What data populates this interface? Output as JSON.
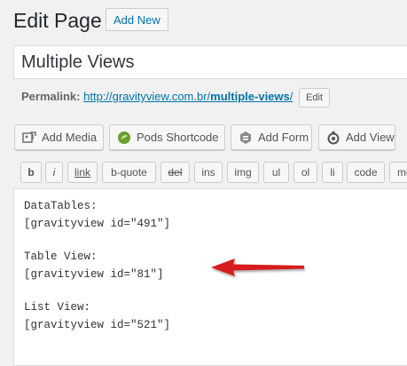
{
  "header": {
    "title": "Edit Page",
    "add_new_label": "Add New"
  },
  "title_field": {
    "value": "Multiple Views"
  },
  "permalink": {
    "label": "Permalink:",
    "url_base": "http://gravityview.com.br/",
    "url_slug": "multiple-views",
    "url_end": "/",
    "edit_label": "Edit"
  },
  "media_buttons": [
    {
      "label": "Add Media",
      "icon": "add-media-icon"
    },
    {
      "label": "Pods Shortcode",
      "icon": "pods-icon"
    },
    {
      "label": "Add Form",
      "icon": "gravity-forms-icon"
    },
    {
      "label": "Add View",
      "icon": "gravityview-icon"
    }
  ],
  "quicktags": [
    "b",
    "i",
    "link",
    "b-quote",
    "del",
    "ins",
    "img",
    "ul",
    "ol",
    "li",
    "code",
    "mo"
  ],
  "editor": {
    "lines": [
      "DataTables:",
      "[gravityview id=\"491\"]",
      "",
      "Table View:",
      "[gravityview id=\"81\"]",
      "",
      "List View:",
      "[gravityview id=\"521\"]"
    ]
  },
  "colors": {
    "link": "#0073aa",
    "arrow": "#d61a1a",
    "background": "#f1f1f1"
  }
}
